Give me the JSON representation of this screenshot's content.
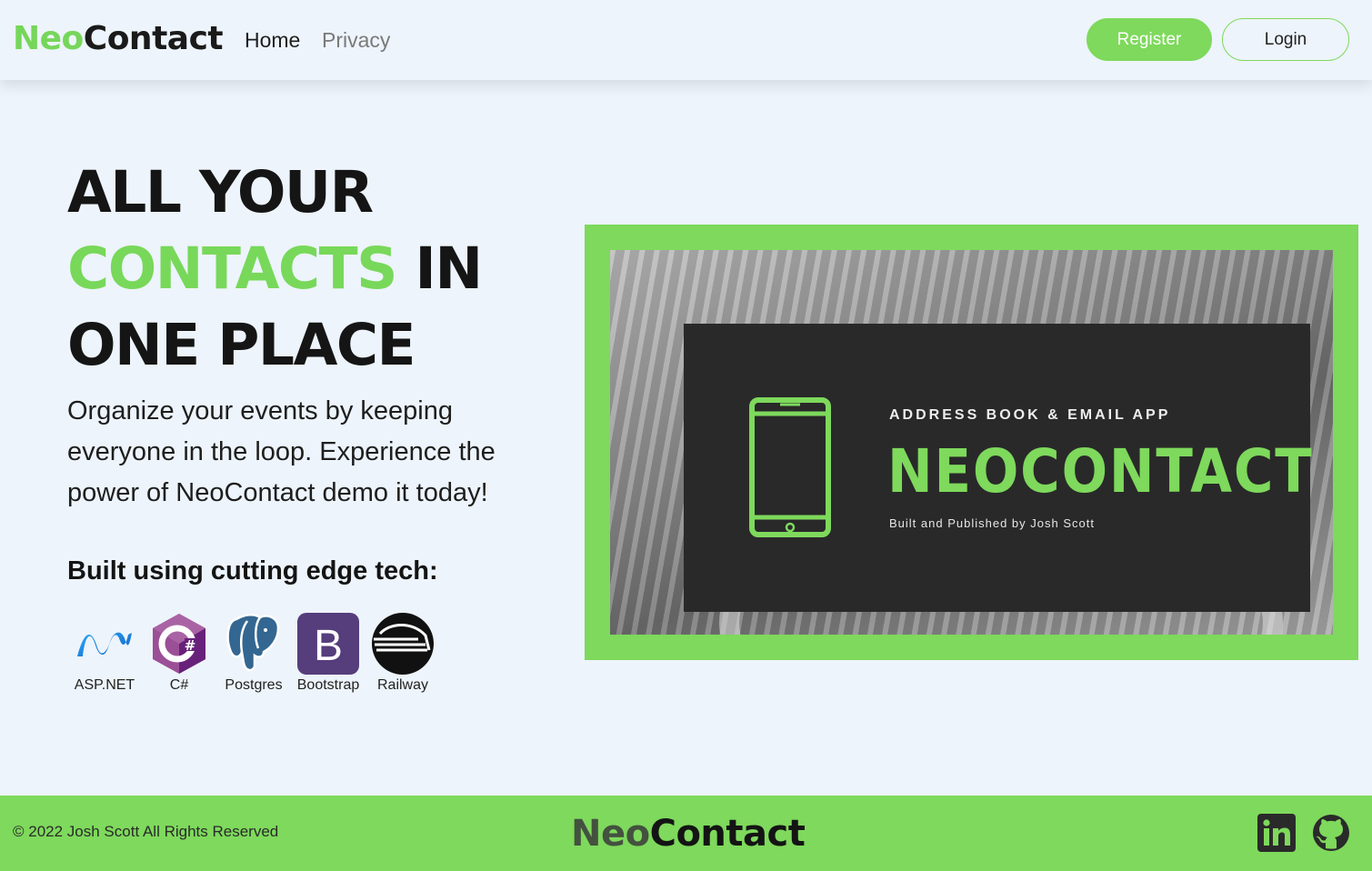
{
  "brand": {
    "prefix": "Neo",
    "suffix": "Contact"
  },
  "nav": {
    "links": [
      {
        "label": "Home"
      },
      {
        "label": "Privacy"
      }
    ],
    "register_label": "Register",
    "login_label": "Login"
  },
  "hero": {
    "title_line1": "ALL YOUR",
    "title_accent": "CONTACTS",
    "title_after_accent": " IN",
    "title_line3": "ONE PLACE",
    "subtitle": "Organize your events by keeping everyone in the loop. Experience the power of NeoContact demo it today!",
    "tech_heading": "Built using cutting edge tech:",
    "tech": [
      {
        "label": "ASP.NET",
        "icon": "aspnet-icon"
      },
      {
        "label": "C#",
        "icon": "csharp-icon"
      },
      {
        "label": "Postgres",
        "icon": "postgres-icon"
      },
      {
        "label": "Bootstrap",
        "icon": "bootstrap-icon"
      },
      {
        "label": "Railway",
        "icon": "railway-icon"
      }
    ]
  },
  "banner": {
    "kicker": "ADDRESS BOOK & EMAIL APP",
    "title": "NEOCONTACT",
    "byline": "Built and Published by Josh Scott",
    "icon": "smartphone-icon"
  },
  "footer": {
    "copyright": "© 2022 Josh Scott All Rights Reserved",
    "brand_prefix": "Neo",
    "brand_suffix": "Contact",
    "social": [
      "linkedin-icon",
      "github-icon"
    ]
  },
  "colors": {
    "accent": "#7ed95c",
    "background": "#edf4fb",
    "card": "#292929"
  }
}
